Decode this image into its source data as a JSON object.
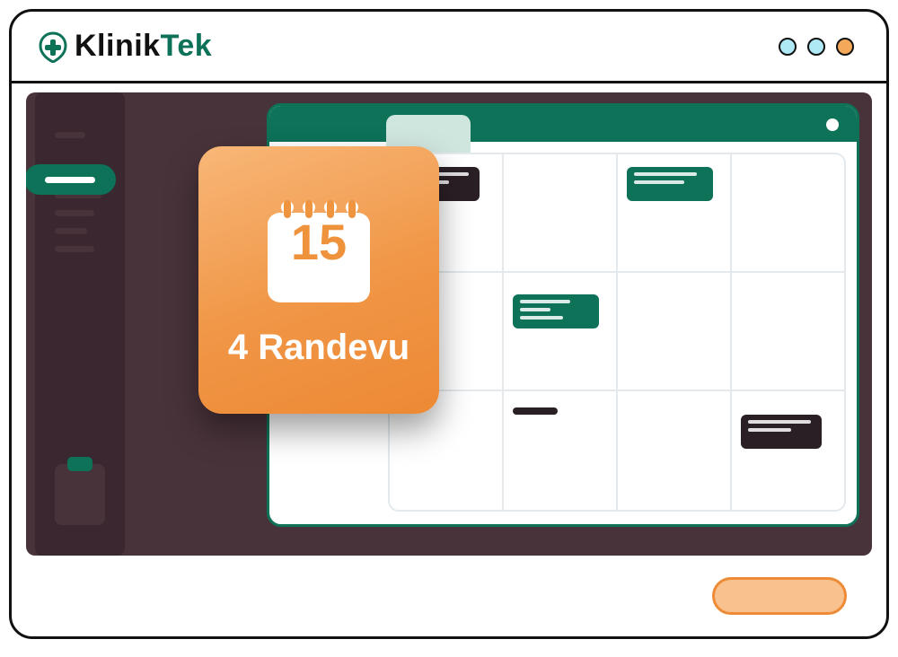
{
  "brand": {
    "part1": "Klinik",
    "part2": "Tek"
  },
  "day_card": {
    "day_number": "15",
    "label": "4 Randevu"
  },
  "colors": {
    "primary": "#0d7258",
    "accent_orange": "#ee8b36",
    "workspace_bg": "#49333a"
  }
}
